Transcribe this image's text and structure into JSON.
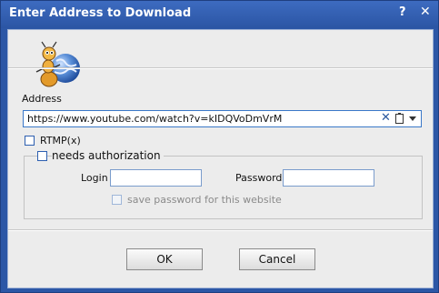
{
  "window": {
    "title": "Enter Address to Download",
    "help_label": "?",
    "close_label": "✕"
  },
  "address": {
    "label": "Address",
    "value": "https://www.youtube.com/watch?v=kIDQVoDmVrM",
    "clear_icon": "clear-icon",
    "paste_icon": "clipboard-icon",
    "dropdown_icon": "dropdown-arrow-icon"
  },
  "rtmp": {
    "label": "RTMP(x)",
    "checked": false
  },
  "auth": {
    "label": "needs authorization",
    "checked": false,
    "login_label": "Login",
    "login_value": "",
    "password_label": "Password",
    "password_value": "",
    "save_label": "save password for this website",
    "save_enabled": false
  },
  "buttons": {
    "ok": "OK",
    "cancel": "Cancel"
  },
  "colors": {
    "titlebar": "#2b55a4",
    "accent": "#3a78c8",
    "background": "#ececec"
  }
}
